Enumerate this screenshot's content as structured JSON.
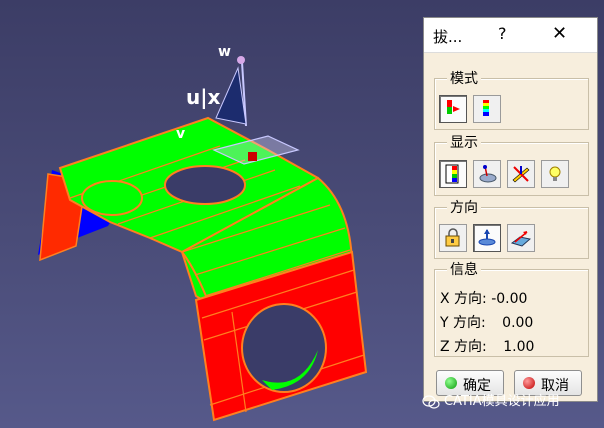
{
  "viewport": {
    "axes": {
      "w_label": "w",
      "u_label": "u|x",
      "v_label": "v"
    }
  },
  "dialog": {
    "title": "拔...",
    "help_symbol": "?",
    "close_symbol": "✕",
    "mode": {
      "label": "模式",
      "buttons": [
        "draft-analysis-mode-icon",
        "curvature-mode-icon"
      ]
    },
    "display": {
      "label": "显示",
      "buttons": [
        "color-scale-icon",
        "on-the-fly-icon",
        "inverse-normal-icon",
        "lighting-icon"
      ]
    },
    "direction": {
      "label": "方向",
      "buttons": [
        "lock-direction-icon",
        "compass-direction-icon",
        "direction-from-axis-icon"
      ]
    },
    "info": {
      "label": "信息",
      "rows": [
        {
          "axis": "X 方向:",
          "value": "-0.00"
        },
        {
          "axis": "Y 方向:",
          "value": "0.00"
        },
        {
          "axis": "Z 方向:",
          "value": "1.00"
        }
      ]
    },
    "ok_label": "确定",
    "cancel_label": "取消"
  },
  "watermark": {
    "text": "CATIA模具设计应用"
  },
  "colors": {
    "part_green": "#00ff00",
    "part_red": "#ff0000",
    "part_blue": "#0000ff",
    "edge_orange": "#ff7f1f",
    "viewport_bg": "#43456f",
    "dialog_bg": "#f7eedd"
  }
}
